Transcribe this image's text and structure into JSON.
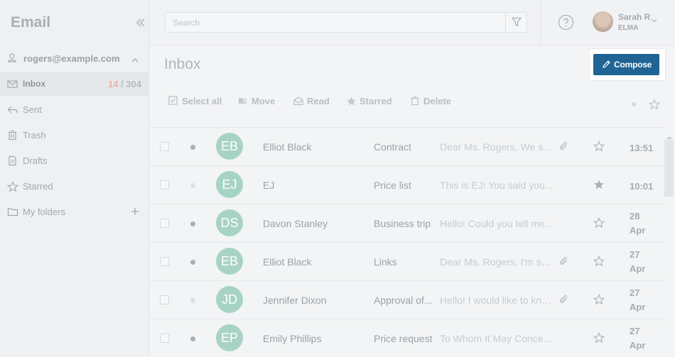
{
  "sidebar": {
    "app_title": "Email",
    "account": "rogers@example.com",
    "items": [
      {
        "label": "Inbox",
        "icon": "envelope-icon",
        "unread": "14",
        "sep": " / ",
        "total": "304"
      },
      {
        "label": "Sent",
        "icon": "reply-icon"
      },
      {
        "label": "Trash",
        "icon": "trash-icon"
      },
      {
        "label": "Drafts",
        "icon": "document-icon"
      },
      {
        "label": "Starred",
        "icon": "star-icon"
      },
      {
        "label": "My folders",
        "icon": "folder-icon"
      }
    ]
  },
  "topbar": {
    "search_placeholder": "Search",
    "user_name": "Sarah R",
    "user_org": "ELMA"
  },
  "main": {
    "title": "Inbox",
    "compose_label": "Compose",
    "toolbar": {
      "select_all": "Select all",
      "move": "Move",
      "read": "Read",
      "starred": "Starred",
      "delete": "Delete"
    }
  },
  "messages": [
    {
      "initials": "EB",
      "sender": "Elliot Black",
      "subject": "Contract",
      "preview": "Dear Ms. Rogers, We s...",
      "attachment": true,
      "starred": false,
      "unread": true,
      "time": "13:51",
      "time2": ""
    },
    {
      "initials": "EJ",
      "sender": "EJ",
      "subject": "Price list",
      "preview": "This is EJ! You said you...",
      "attachment": false,
      "starred": true,
      "unread": false,
      "time": "10:01",
      "time2": ""
    },
    {
      "initials": "DS",
      "sender": "Davon Stanley",
      "subject": "Business trip",
      "preview": "Hello! Could you tell me...",
      "attachment": false,
      "starred": false,
      "unread": true,
      "time": "28",
      "time2": "Apr"
    },
    {
      "initials": "EB",
      "sender": "Elliot Black",
      "subject": "Links",
      "preview": "Dear Ms. Rogers, I'm se...",
      "attachment": true,
      "starred": false,
      "unread": true,
      "time": "27",
      "time2": "Apr"
    },
    {
      "initials": "JD",
      "sender": "Jennifer Dixon",
      "subject": "Approval of...",
      "preview": "Hello! I would like to kno...",
      "attachment": true,
      "starred": false,
      "unread": false,
      "time": "27",
      "time2": "Apr"
    },
    {
      "initials": "EP",
      "sender": "Emily Phillips",
      "subject": "Price request",
      "preview": "To Whom It May Conce...",
      "attachment": false,
      "starred": false,
      "unread": true,
      "time": "27",
      "time2": "Apr"
    }
  ],
  "colors": {
    "accent": "#1f6494",
    "avatar": "#a7d3c6",
    "unread_count": "#e6b0ab"
  }
}
